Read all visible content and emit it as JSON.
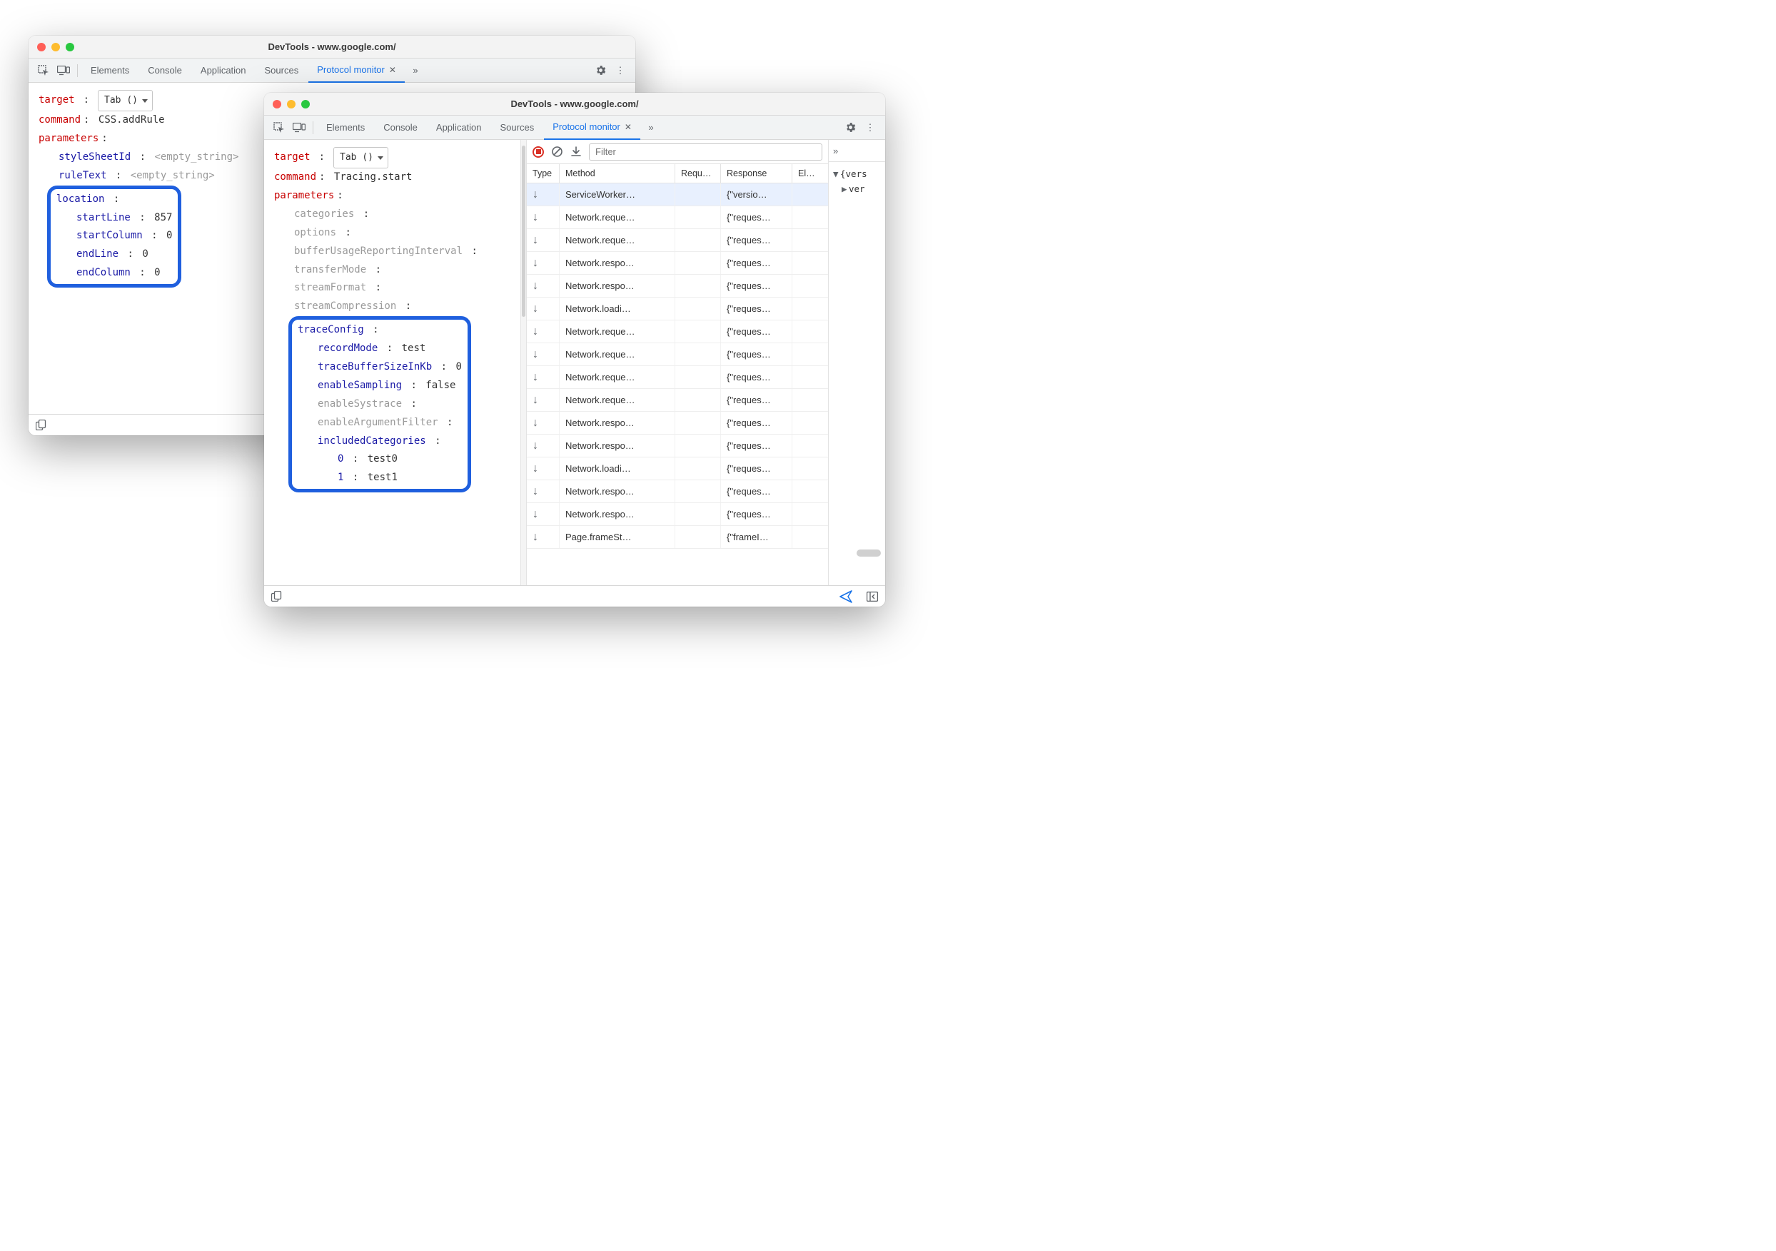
{
  "windowA": {
    "title": "DevTools - www.google.com/",
    "tabs": [
      "Elements",
      "Console",
      "Application",
      "Sources",
      "Protocol monitor"
    ],
    "activeTab": "Protocol monitor",
    "target": {
      "label": "target",
      "value": "Tab ()"
    },
    "command": {
      "label": "command",
      "value": "CSS.addRule"
    },
    "parametersLabel": "parameters",
    "params": {
      "styleSheetId": {
        "key": "styleSheetId",
        "value": "<empty_string>"
      },
      "ruleText": {
        "key": "ruleText",
        "value": "<empty_string>"
      }
    },
    "location": {
      "key": "location",
      "startLine": {
        "key": "startLine",
        "value": "857"
      },
      "startColumn": {
        "key": "startColumn",
        "value": "0"
      },
      "endLine": {
        "key": "endLine",
        "value": "0"
      },
      "endColumn": {
        "key": "endColumn",
        "value": "0"
      }
    }
  },
  "windowB": {
    "title": "DevTools - www.google.com/",
    "tabs": [
      "Elements",
      "Console",
      "Application",
      "Sources",
      "Protocol monitor"
    ],
    "activeTab": "Protocol monitor",
    "target": {
      "label": "target",
      "value": "Tab ()"
    },
    "command": {
      "label": "command",
      "value": "Tracing.start"
    },
    "parametersLabel": "parameters",
    "plainParams": {
      "categories": "categories",
      "options": "options",
      "bufferUsageReportingInterval": "bufferUsageReportingInterval",
      "transferMode": "transferMode",
      "streamFormat": "streamFormat",
      "streamCompression": "streamCompression"
    },
    "traceConfig": {
      "key": "traceConfig",
      "recordMode": {
        "key": "recordMode",
        "value": "test"
      },
      "traceBufferSizeInKb": {
        "key": "traceBufferSizeInKb",
        "value": "0"
      },
      "enableSampling": {
        "key": "enableSampling",
        "value": "false"
      },
      "enableSystrace": "enableSystrace",
      "enableArgumentFilter": "enableArgumentFilter",
      "includedCategories": {
        "key": "includedCategories",
        "items": [
          {
            "idx": "0",
            "val": "test0"
          },
          {
            "idx": "1",
            "val": "test1"
          }
        ]
      }
    },
    "log": {
      "filterPlaceholder": "Filter",
      "columns": {
        "type": "Type",
        "method": "Method",
        "request": "Requ…",
        "response": "Response",
        "elapsed": "El…"
      },
      "rows": [
        {
          "method": "ServiceWorker…",
          "response": "{\"versio…",
          "sel": true
        },
        {
          "method": "Network.reque…",
          "response": "{\"reques…"
        },
        {
          "method": "Network.reque…",
          "response": "{\"reques…"
        },
        {
          "method": "Network.respo…",
          "response": "{\"reques…"
        },
        {
          "method": "Network.respo…",
          "response": "{\"reques…"
        },
        {
          "method": "Network.loadi…",
          "response": "{\"reques…"
        },
        {
          "method": "Network.reque…",
          "response": "{\"reques…"
        },
        {
          "method": "Network.reque…",
          "response": "{\"reques…"
        },
        {
          "method": "Network.reque…",
          "response": "{\"reques…"
        },
        {
          "method": "Network.reque…",
          "response": "{\"reques…"
        },
        {
          "method": "Network.respo…",
          "response": "{\"reques…"
        },
        {
          "method": "Network.respo…",
          "response": "{\"reques…"
        },
        {
          "method": "Network.loadi…",
          "response": "{\"reques…"
        },
        {
          "method": "Network.respo…",
          "response": "{\"reques…"
        },
        {
          "method": "Network.respo…",
          "response": "{\"reques…"
        },
        {
          "method": "Page.frameSt…",
          "response": "{\"frameI…"
        }
      ]
    },
    "sidePane": {
      "overflowLabel": "»",
      "line1": "{vers",
      "line2": "ver"
    }
  }
}
